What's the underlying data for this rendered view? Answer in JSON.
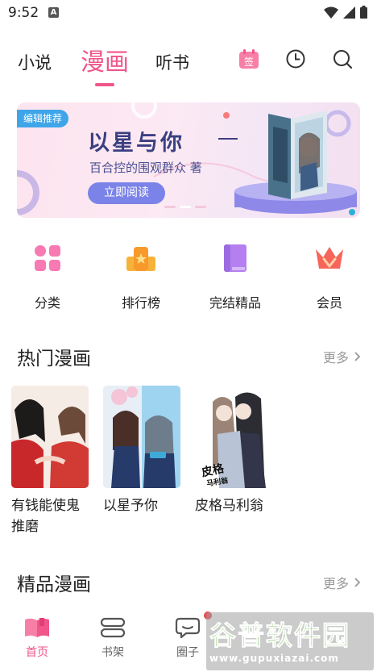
{
  "status_bar": {
    "time": "9:52",
    "notification_letter": "A"
  },
  "top_nav": {
    "tabs": [
      {
        "label": "小说"
      },
      {
        "label": "漫画",
        "active": true
      },
      {
        "label": "听书"
      }
    ],
    "icons": [
      "sign-in-calendar-icon",
      "history-clock-icon",
      "search-icon"
    ],
    "sign_badge": "签",
    "accent_color": "#f0558b"
  },
  "banner": {
    "tag": "编辑推荐",
    "title": "以星与你",
    "subtitle": "百合控的围观群众 著",
    "button": "立即阅读",
    "slides_count": 3,
    "active_slide": 2
  },
  "quick_links": [
    {
      "label": "分类",
      "icon": "category-grid-icon"
    },
    {
      "label": "排行榜",
      "icon": "ranking-podium-icon"
    },
    {
      "label": "完结精品",
      "icon": "finished-book-icon"
    },
    {
      "label": "会员",
      "icon": "vip-crown-icon"
    }
  ],
  "hot_section": {
    "title": "热门漫画",
    "more": "更多"
  },
  "hot_comics": [
    {
      "title": "有钱能使鬼推磨"
    },
    {
      "title": "以星予你"
    },
    {
      "title": "皮格马利翁"
    }
  ],
  "cover_lettering": "皮格马利翁",
  "premium_section": {
    "title": "精品漫画",
    "more": "更多"
  },
  "bottom_nav": [
    {
      "label": "首页",
      "icon": "home-book-icon",
      "active": true
    },
    {
      "label": "书架",
      "icon": "bookshelf-icon"
    },
    {
      "label": "圈子",
      "icon": "chat-bubble-icon"
    }
  ],
  "watermark": {
    "title": "谷普软件园",
    "url": "www.gupuxiazai.com"
  }
}
